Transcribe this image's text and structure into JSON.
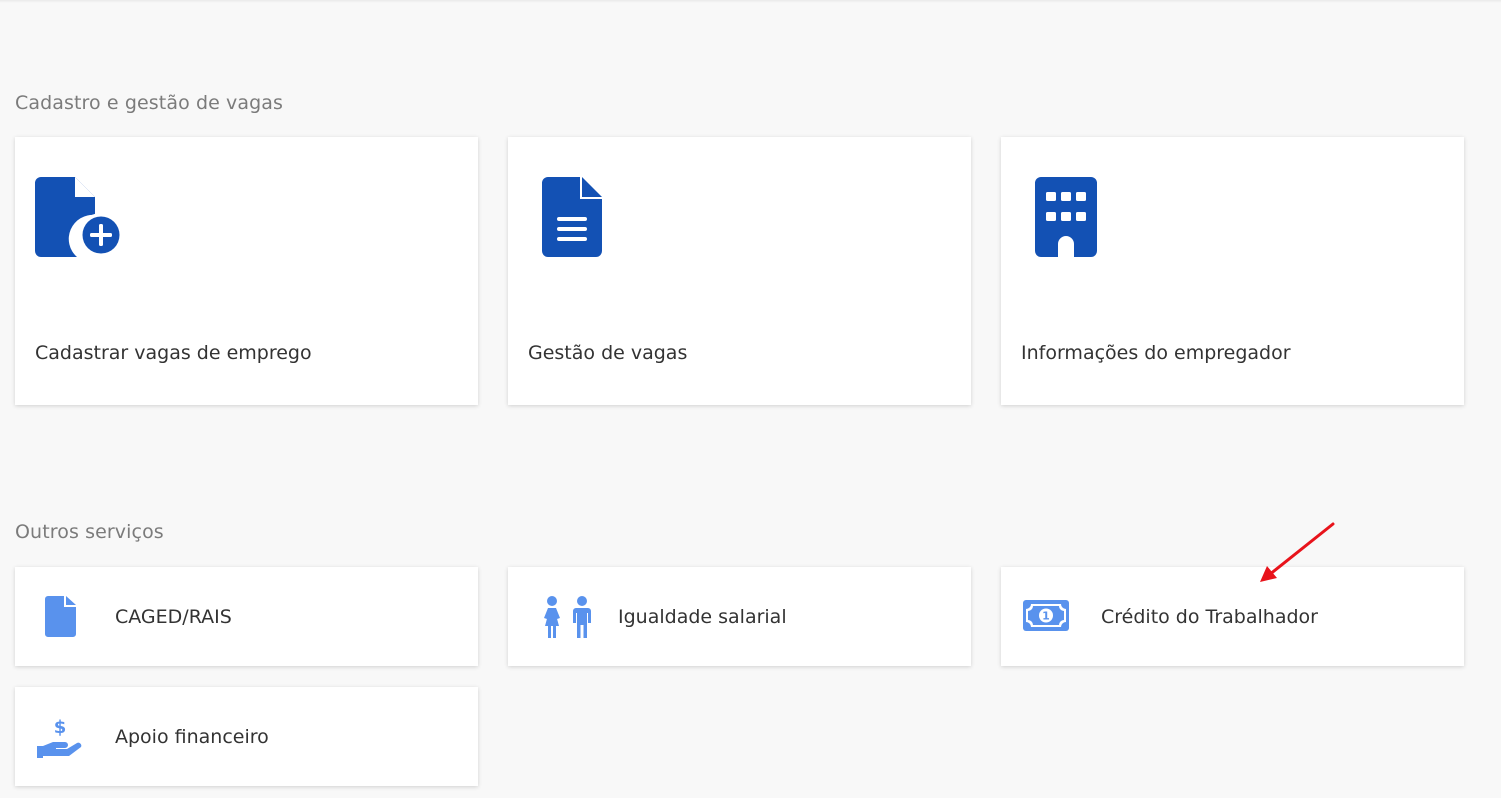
{
  "sections": {
    "vagas": {
      "title": "Cadastro e gestão de vagas",
      "cards": [
        {
          "label": "Cadastrar vagas de emprego",
          "icon": "file-plus-icon"
        },
        {
          "label": "Gestão de vagas",
          "icon": "file-lines-icon"
        },
        {
          "label": "Informações do empregador",
          "icon": "building-icon"
        }
      ]
    },
    "outros": {
      "title": "Outros serviços",
      "cards": [
        {
          "label": "CAGED/RAIS",
          "icon": "file-icon"
        },
        {
          "label": "Igualdade salarial",
          "icon": "people-icon"
        },
        {
          "label": "Crédito do Trabalhador",
          "icon": "money-bill-icon"
        },
        {
          "label": "Apoio financeiro",
          "icon": "hand-dollar-icon"
        }
      ]
    }
  },
  "colors": {
    "primary_icon": "#1351b4",
    "secondary_icon": "#5992ed",
    "annotation_arrow": "#e8131b"
  }
}
